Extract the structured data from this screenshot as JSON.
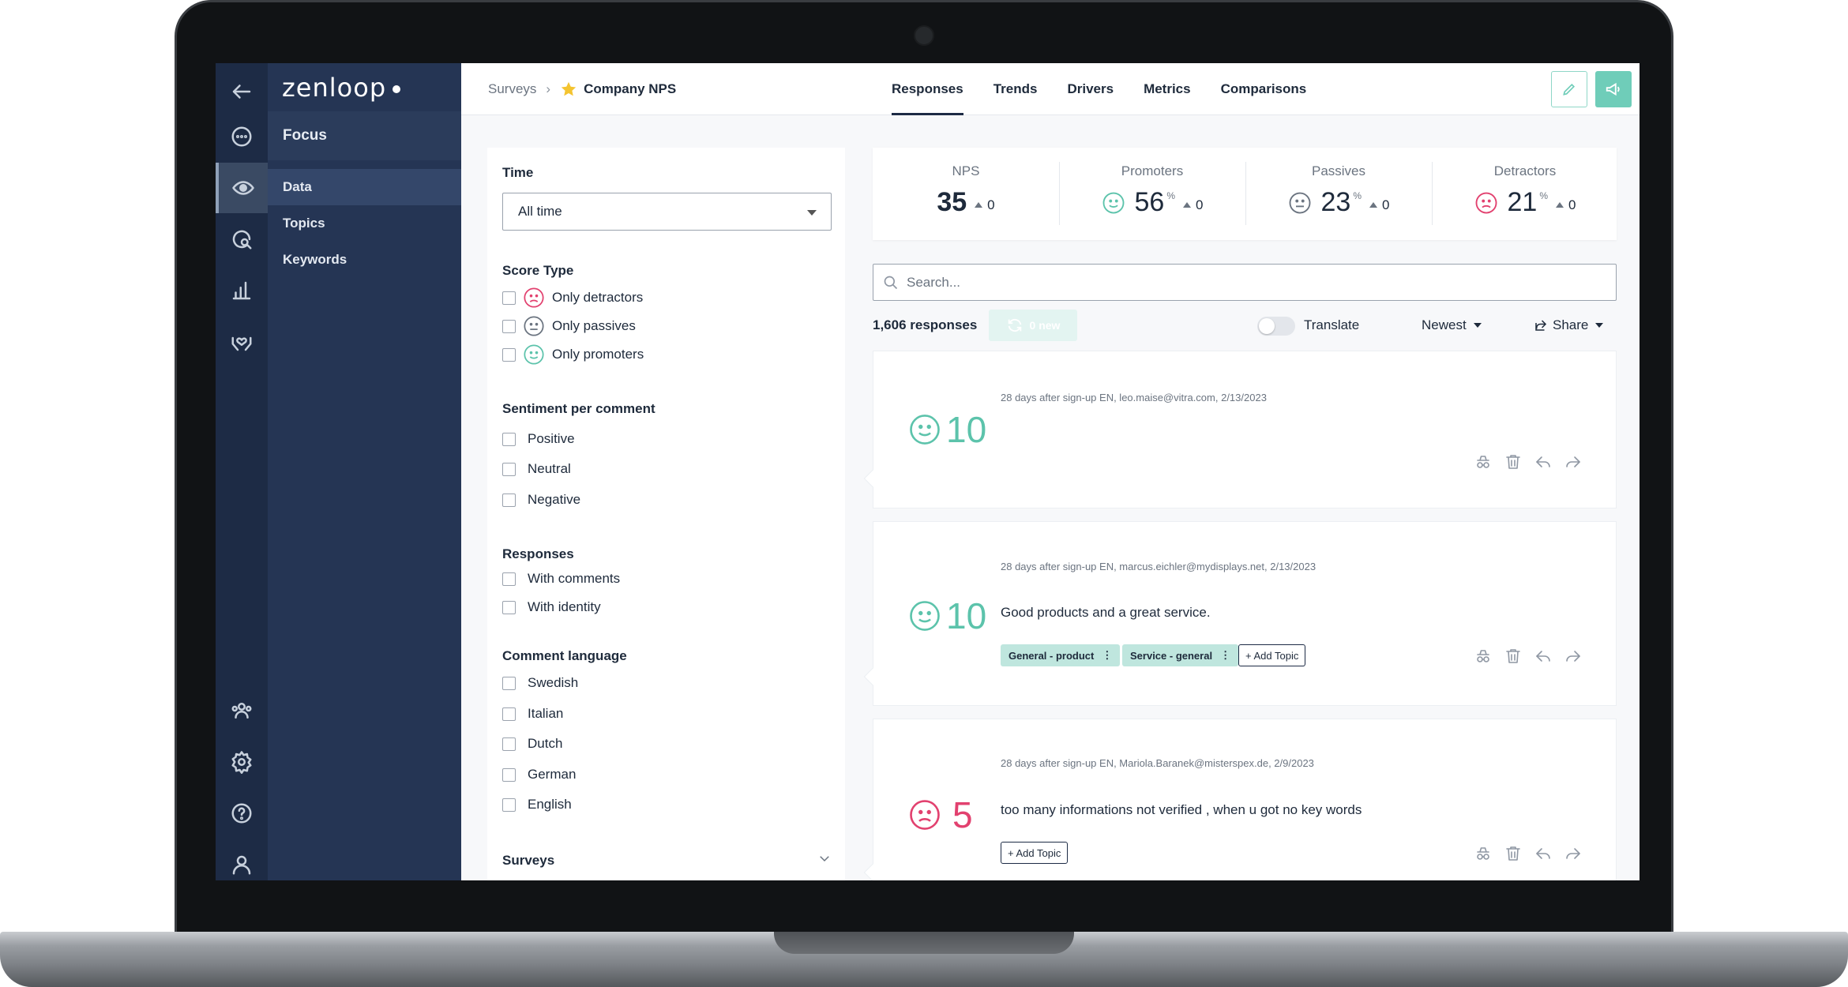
{
  "app": {
    "logo": "zenloop"
  },
  "subnav": {
    "heading": "Focus",
    "items": [
      {
        "label": "Data"
      },
      {
        "label": "Topics"
      },
      {
        "label": "Keywords"
      }
    ]
  },
  "breadcrumb": {
    "parent": "Surveys",
    "current": "Company NPS"
  },
  "tabs": [
    {
      "label": "Responses"
    },
    {
      "label": "Trends"
    },
    {
      "label": "Drivers"
    },
    {
      "label": "Metrics"
    },
    {
      "label": "Comparisons"
    }
  ],
  "filters": {
    "time_label": "Time",
    "time_value": "All time",
    "score_type_label": "Score Type",
    "score_type": [
      "Only detractors",
      "Only passives",
      "Only promoters"
    ],
    "sentiment_label": "Sentiment per comment",
    "sentiment": [
      "Positive",
      "Neutral",
      "Negative"
    ],
    "responses_label": "Responses",
    "responses": [
      "With comments",
      "With identity"
    ],
    "language_label": "Comment language",
    "languages": [
      "Swedish",
      "Italian",
      "Dutch",
      "German",
      "English"
    ],
    "surveys_label": "Surveys"
  },
  "stats": [
    {
      "label": "NPS",
      "value": "35",
      "pct": "",
      "delta": "0"
    },
    {
      "label": "Promoters",
      "value": "56",
      "pct": "%",
      "delta": "0"
    },
    {
      "label": "Passives",
      "value": "23",
      "pct": "%",
      "delta": "0"
    },
    {
      "label": "Detractors",
      "value": "21",
      "pct": "%",
      "delta": "0"
    }
  ],
  "search": {
    "placeholder": "Search..."
  },
  "toolbar": {
    "count": "1,606 responses",
    "new_label": "0 new",
    "translate": "Translate",
    "sort": "Newest",
    "share": "Share"
  },
  "responses": [
    {
      "score": "10",
      "type": "promoter",
      "meta": "28 days after sign-up EN, leo.maise@vitra.com, 2/13/2023",
      "comment": "",
      "topics": [],
      "add_topic": ""
    },
    {
      "score": "10",
      "type": "promoter",
      "meta": "28 days after sign-up EN, marcus.eichler@mydisplays.net, 2/13/2023",
      "comment": "Good products and a great service.",
      "topics": [
        "General - product",
        "Service - general"
      ],
      "add_topic": "+ Add Topic"
    },
    {
      "score": "5",
      "type": "detractor",
      "meta": "28 days after sign-up EN, Mariola.Baranek@misterspex.de, 2/9/2023",
      "comment": "too many informations not verified , when u got no key words",
      "topics": [],
      "add_topic": "+ Add Topic"
    }
  ],
  "colors": {
    "promoter": "#5cc3ab",
    "passive": "#6b7480",
    "detractor": "#e2416f",
    "accent": "#6fcdb9",
    "sidebar": "#1d2b45"
  }
}
